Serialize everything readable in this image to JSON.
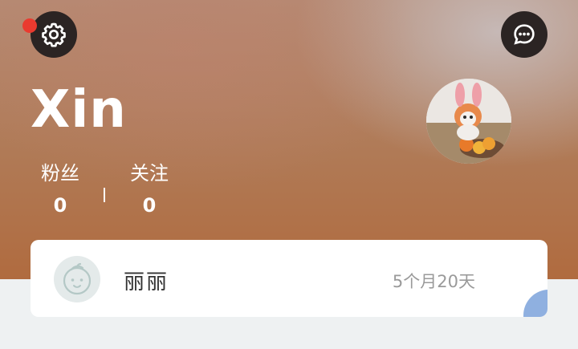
{
  "profile": {
    "username": "Xin",
    "fans_label": "粉丝",
    "fans_count": "0",
    "follow_label": "关注",
    "follow_count": "0"
  },
  "icons": {
    "settings": "gear-icon",
    "chat": "chat-bubble-icon",
    "notification": "red-dot-badge",
    "card_avatar": "baby-face-icon"
  },
  "card": {
    "name": "丽丽",
    "age": "5个月20天"
  },
  "colors": {
    "badge": "#ea3a2f",
    "button_bg": "#2b2423",
    "card_bg": "#ffffff",
    "page_bg": "#eef1f2",
    "corner_accent": "#8fb0e0"
  }
}
